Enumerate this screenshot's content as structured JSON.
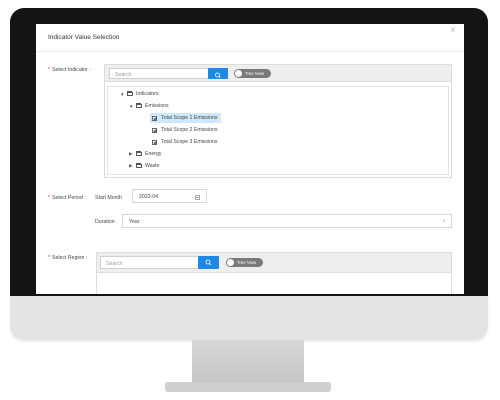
{
  "dialog": {
    "title": "Indicator Value Selection",
    "close_icon": "×"
  },
  "indicator": {
    "label": "Select Indicator :",
    "search_placeholder": "Search",
    "toggle_label": "Tree View",
    "tree": {
      "root": "Indicators",
      "group": "Emissions",
      "leaves": [
        "Total Scope 1 Emissions",
        "Total Scope 2 Emissions",
        "Total Scope 3 Emissions"
      ],
      "others": [
        "Energy",
        "Waste"
      ]
    }
  },
  "period": {
    "label": "Select Period :",
    "start_label": "Start Month",
    "start_value": "2022-04",
    "duration_label": "Duration",
    "duration_value": "Year"
  },
  "region": {
    "label": "Select Region :",
    "search_placeholder": "Search",
    "toggle_label": "Tree View"
  },
  "colors": {
    "accent": "#1e88e5",
    "required": "#e53935",
    "selected_row": "#cfe8fb"
  }
}
